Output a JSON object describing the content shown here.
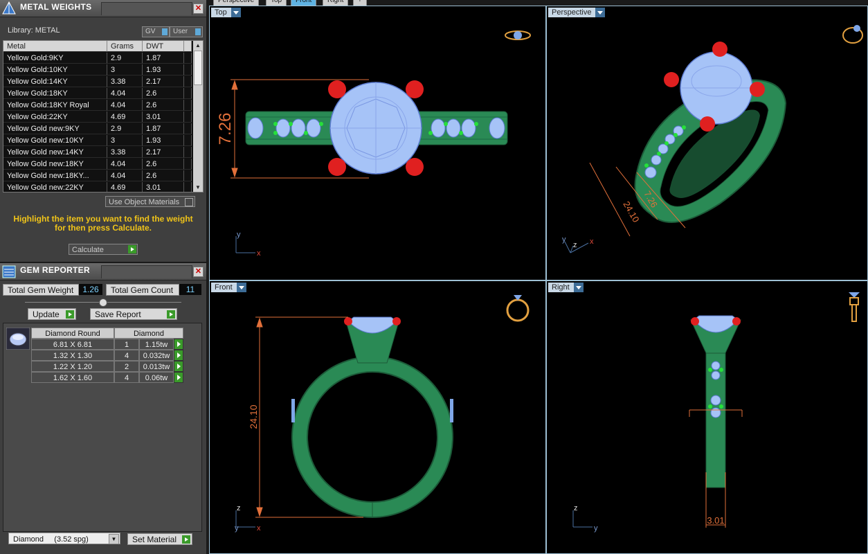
{
  "metal_weights": {
    "title": "METAL WEIGHTS",
    "library_label": "Library: METAL",
    "gv_label": "GV",
    "user_label": "User",
    "columns": [
      "Metal",
      "Grams",
      "DWT"
    ],
    "rows": [
      {
        "metal": "Yellow Gold:9KY",
        "grams": "2.9",
        "dwt": "1.87"
      },
      {
        "metal": "Yellow Gold:10KY",
        "grams": "3",
        "dwt": "1.93"
      },
      {
        "metal": "Yellow Gold:14KY",
        "grams": "3.38",
        "dwt": "2.17"
      },
      {
        "metal": "Yellow Gold:18KY",
        "grams": "4.04",
        "dwt": "2.6"
      },
      {
        "metal": "Yellow Gold:18KY Royal",
        "grams": "4.04",
        "dwt": "2.6"
      },
      {
        "metal": "Yellow Gold:22KY",
        "grams": "4.69",
        "dwt": "3.01"
      },
      {
        "metal": "Yellow Gold new:9KY",
        "grams": "2.9",
        "dwt": "1.87"
      },
      {
        "metal": "Yellow Gold new:10KY",
        "grams": "3",
        "dwt": "1.93"
      },
      {
        "metal": "Yellow Gold new:14KY",
        "grams": "3.38",
        "dwt": "2.17"
      },
      {
        "metal": "Yellow Gold new:18KY",
        "grams": "4.04",
        "dwt": "2.6"
      },
      {
        "metal": "Yellow Gold new:18KY...",
        "grams": "4.04",
        "dwt": "2.6"
      },
      {
        "metal": "Yellow Gold new:22KY",
        "grams": "4.69",
        "dwt": "3.01"
      }
    ],
    "use_object_materials": "Use Object Materials",
    "hint": "Highlight the item you want to find the weight for then press Calculate.",
    "calculate_label": "Calculate"
  },
  "gem_reporter": {
    "title": "GEM REPORTER",
    "total_weight_label": "Total Gem Weight",
    "total_weight_value": "1.26",
    "total_count_label": "Total Gem Count",
    "total_count_value": "11",
    "update_label": "Update",
    "save_report_label": "Save Report",
    "columns": [
      "Diamond Round",
      "Diamond"
    ],
    "rows": [
      {
        "size": "6.81 X 6.81",
        "count": "1",
        "weight": "1.15tw"
      },
      {
        "size": "1.32 X 1.30",
        "count": "4",
        "weight": "0.032tw"
      },
      {
        "size": "1.22 X 1.20",
        "count": "2",
        "weight": "0.013tw"
      },
      {
        "size": "1.62 X 1.60",
        "count": "4",
        "weight": "0.06tw"
      }
    ],
    "material_select": "Diamond     (3.52 spg)",
    "set_material_label": "Set Material"
  },
  "view_tabs": [
    "Perspective",
    "Top",
    "Front",
    "Right"
  ],
  "viewports": {
    "top": {
      "label": "Top",
      "dimension": "7.26"
    },
    "perspective": {
      "label": "Perspective",
      "dimension_a": "24.10",
      "dimension_b": "7.26"
    },
    "front": {
      "label": "Front",
      "dimension": "24.10"
    },
    "right": {
      "label": "Right",
      "dimension": "3.01"
    }
  },
  "axes": {
    "x": "x",
    "y": "y",
    "z": "z"
  },
  "colors": {
    "metal_green": "#2a8a55",
    "gem_blue": "#a6c3f7",
    "prong_red": "#e02020",
    "dimension_orange": "#e2703a",
    "hint_yellow": "#f0c419"
  }
}
